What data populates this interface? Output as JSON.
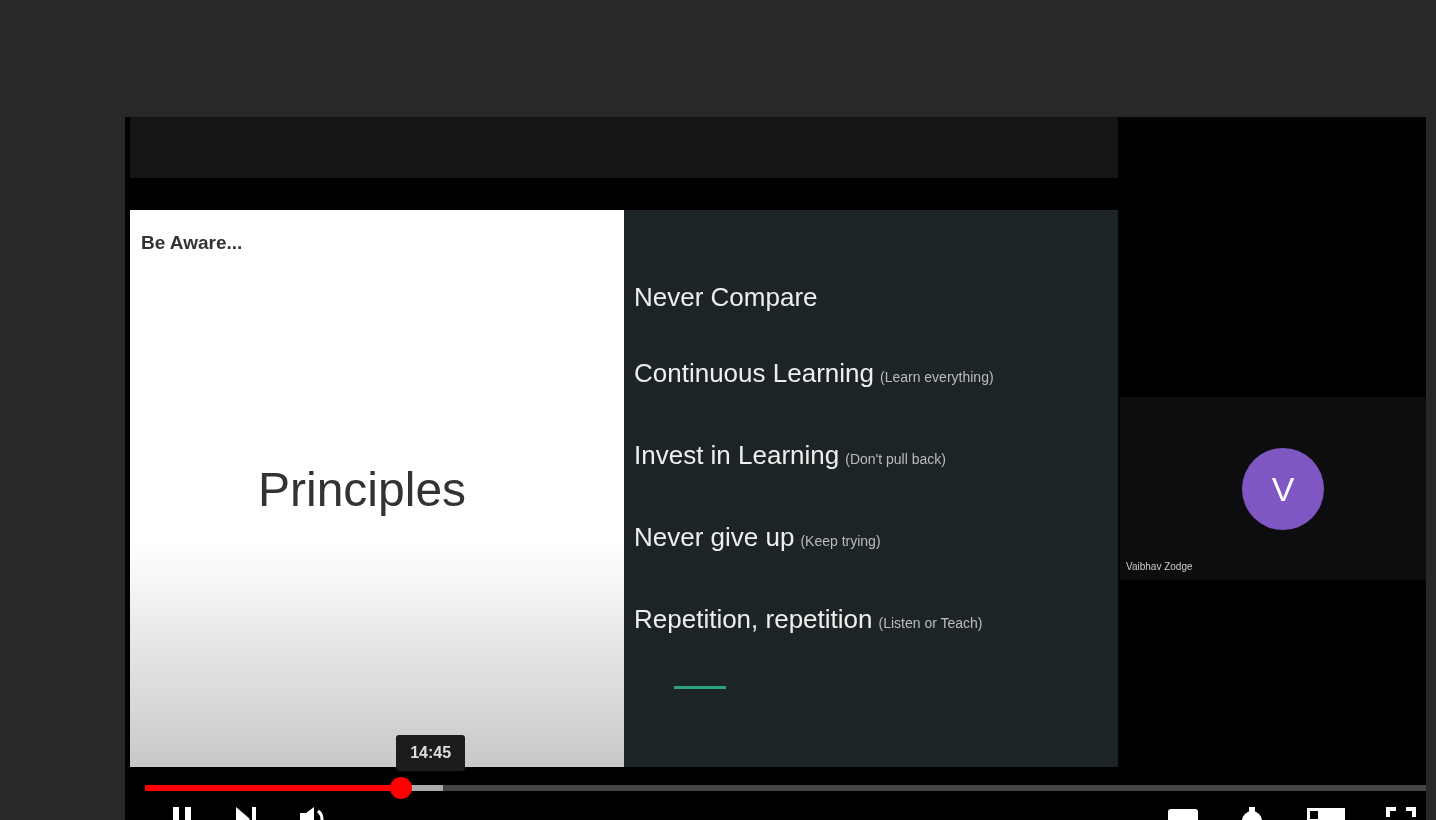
{
  "slide": {
    "heading": "Be Aware...",
    "title": "Principles",
    "points": [
      {
        "text": "Never Compare"
      },
      {
        "text": "Continuous Learning",
        "note": "(Learn everything)"
      },
      {
        "text": "Invest in Learning",
        "note": "(Don't pull back)"
      },
      {
        "text": "Never give up",
        "note": "(Keep trying)"
      },
      {
        "text": "Repetition, repetition",
        "note": "(Listen or Teach)"
      }
    ]
  },
  "participant": {
    "initial": "V",
    "name": "Vaibhav Zodge",
    "color": "#7e57c2"
  },
  "seek_bar": {
    "played": {
      "level": 0.2
    },
    "buffered": {
      "level": 0.233
    },
    "tooltip": "14:45"
  }
}
